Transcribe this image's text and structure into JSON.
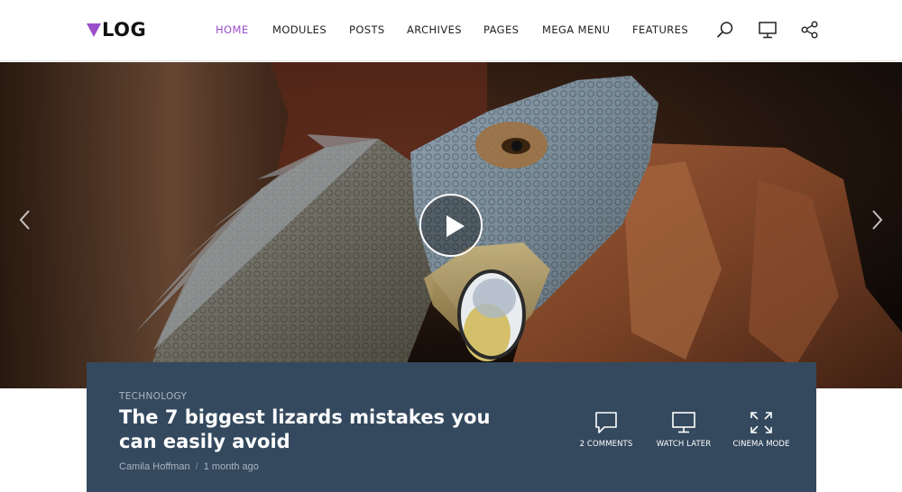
{
  "logo": {
    "text": "LOG",
    "accent": "#9b4dca"
  },
  "nav": {
    "items": [
      {
        "label": "HOME",
        "active": true
      },
      {
        "label": "MODULES",
        "active": false
      },
      {
        "label": "POSTS",
        "active": false
      },
      {
        "label": "ARCHIVES",
        "active": false
      },
      {
        "label": "PAGES",
        "active": false
      },
      {
        "label": "MEGA MENU",
        "active": false
      },
      {
        "label": "FEATURES",
        "active": false
      }
    ],
    "icons": [
      "search-icon",
      "monitor-icon",
      "share-icon"
    ]
  },
  "hero": {
    "image": "iguana-photo",
    "controls": [
      "prev-arrow-icon",
      "play-icon",
      "next-arrow-icon"
    ]
  },
  "post": {
    "category": "TECHNOLOGY",
    "title": "The 7 biggest lizards mistakes you can easily avoid",
    "author": "Camila Hoffman",
    "separator": "/",
    "date": "1 month ago",
    "actions": [
      {
        "label": "2 COMMENTS",
        "icon": "comment-icon"
      },
      {
        "label": "WATCH LATER",
        "icon": "monitor-icon"
      },
      {
        "label": "CINEMA MODE",
        "icon": "expand-icon"
      }
    ]
  },
  "colors": {
    "panel": "#34495e",
    "accent": "#9b4dca"
  }
}
